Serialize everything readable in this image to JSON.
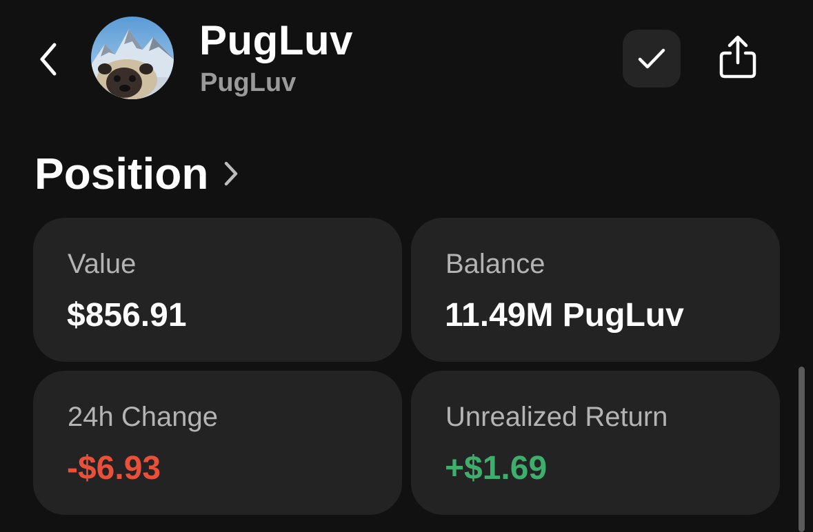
{
  "header": {
    "title": "PugLuv",
    "subtitle": "PugLuv",
    "back_icon": "chevron-left-icon",
    "check_icon": "checkmark-icon",
    "share_icon": "share-icon"
  },
  "position": {
    "title": "Position",
    "chevron_icon": "chevron-right-icon"
  },
  "cards": {
    "value": {
      "label": "Value",
      "amount": "$856.91"
    },
    "balance": {
      "label": "Balance",
      "amount": "11.49M PugLuv"
    },
    "change_24h": {
      "label": "24h Change",
      "amount": "-$6.93"
    },
    "unrealized_return": {
      "label": "Unrealized Return",
      "amount": "+$1.69"
    }
  },
  "colors": {
    "background": "#111111",
    "card": "#232323",
    "negative": "#e8503a",
    "positive": "#3fae6c",
    "secondary_text": "#9a9a9a"
  }
}
